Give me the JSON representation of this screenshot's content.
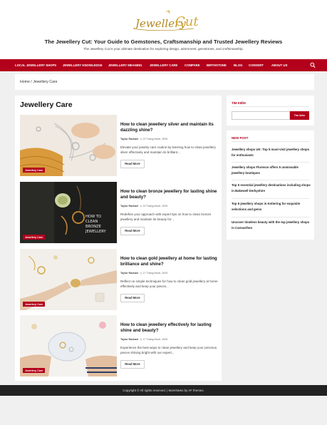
{
  "site": {
    "logo_text": "Jewellery Cut",
    "title": "The Jewellery Cut: Your Guide to Gemstones, Craftsmanship and Trusted Jewellery Reviews",
    "description": "The Jewellery Cut is your ultimate destination for exploring design, adornment, gemstones, and craftsmanship."
  },
  "nav": {
    "items": [
      "LOCAL JEWELLERY SHOPS",
      "JEWELLERY KNOWLEDGE",
      "JEWELLERY MEANING",
      "JEWELLERY CARE",
      "COMPARE",
      "BIRTHSTONE",
      "BLOG",
      "CONVERT",
      "ABOUT US"
    ],
    "search_icon": "search-icon"
  },
  "breadcrumb": {
    "home": "Home",
    "separator": "/",
    "current": "Jewellery Care"
  },
  "page": {
    "title": "Jewellery Care"
  },
  "posts": [
    {
      "title": "How to clean jewellery silver and maintain its dazzling shine?",
      "author": "Taylor Rachael",
      "date": "22 Tháng Mười, 2025",
      "excerpt": "Elevate your jewelry care routine by learning how to clean jewellery silver effectively and maintain its brilliant...",
      "category": "Jewellery Care",
      "read_more": "Read More"
    },
    {
      "title": "How to clean bronze jewellery for lasting shine and beauty?",
      "author": "Taylor Rachael",
      "date": "20 Tháng Mười, 2025",
      "excerpt": "Redefine your approach with expert tips on how to clean bronze jewellery and maintain its beauty for...",
      "category": "Jewellery Care",
      "read_more": "Read More",
      "image_text": "HOW TO CLEAN BRONZE JEWELLERY"
    },
    {
      "title": "How to clean gold jewellery at home for lasting brilliance and shine?",
      "author": "Taylor Rachael",
      "date": "17 Tháng Mười, 2025",
      "excerpt": "Reflect on simple techniques for how to clean gold jewellery at home effectively and keep your pieces...",
      "category": "Jewellery Care",
      "read_more": "Read More"
    },
    {
      "title": "How to clean jewellery effectively for lasting shine and beauty?",
      "author": "Taylor Rachael",
      "date": "17 Tháng Mười, 2025",
      "excerpt": "Experience the best ways to clean jewellery and keep your precious pieces shining bright with our expert...",
      "category": "Jewellery Care",
      "read_more": "Read More"
    }
  ],
  "sidebar": {
    "search": {
      "title": "TÌM KIẾM",
      "placeholder": "",
      "button": "Tìm kiếm"
    },
    "recent": {
      "title": "NEW POST",
      "items": [
        "Jewellery shops UK: Top 5 must-visit jewellery shops for enthusiasts",
        "Jewellery shops Florence offers 5 unmissable jewellery boutiques",
        "Top 5 essential jewellery destinations including shops in Bakewell Derbyshire",
        "Top 6 jewellery shops in Kettering for exquisite selections and gems",
        "Uncover timeless beauty with the top jewellery shops in Carmarthen"
      ]
    }
  },
  "footer": {
    "text": "Copyright © All rights reserved. | MoreNews by AF themes."
  },
  "colors": {
    "accent": "#b3001b",
    "footer_bg": "#222222",
    "page_bg": "#f0f0f0"
  }
}
